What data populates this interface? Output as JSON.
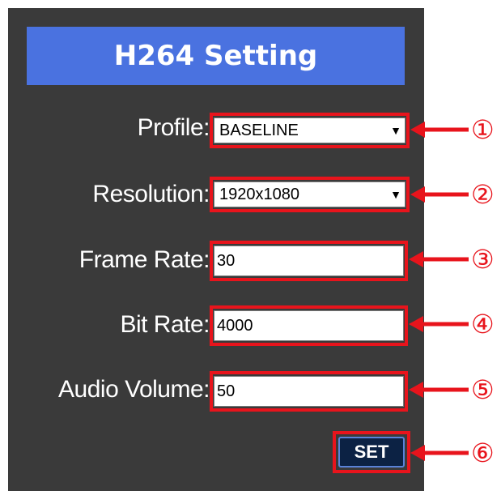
{
  "header": {
    "title": "H264 Setting"
  },
  "fields": {
    "profile": {
      "label": "Profile:",
      "value": "BASELINE",
      "caret": "▼",
      "marker": "①"
    },
    "resolution": {
      "label": "Resolution:",
      "value": "1920x1080",
      "caret": "▼",
      "marker": "②"
    },
    "frame_rate": {
      "label": "Frame Rate:",
      "value": "30",
      "marker": "③"
    },
    "bit_rate": {
      "label": "Bit Rate:",
      "value": "4000",
      "marker": "④"
    },
    "audio_volume": {
      "label": "Audio Volume:",
      "value": "50",
      "marker": "⑤"
    }
  },
  "set_button": {
    "label": "SET",
    "marker": "⑥"
  },
  "colors": {
    "panel": "#3a3a3a",
    "header": "#4a72e0",
    "highlight": "#e8141c",
    "button": "#0c2244"
  }
}
